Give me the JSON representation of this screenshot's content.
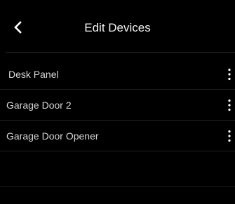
{
  "header": {
    "title": "Edit Devices",
    "back_icon": "chevron-left-icon"
  },
  "devices": [
    {
      "name": "Desk Panel",
      "menu_icon": "more-vertical-icon"
    },
    {
      "name": "Garage Door 2",
      "menu_icon": "more-vertical-icon"
    },
    {
      "name": "Garage Door Opener",
      "menu_icon": "more-vertical-icon"
    }
  ],
  "colors": {
    "background": "#000000",
    "title_text": "#f2f2f2",
    "item_text": "#d6d6d6",
    "divider": "#2a2a2a"
  }
}
